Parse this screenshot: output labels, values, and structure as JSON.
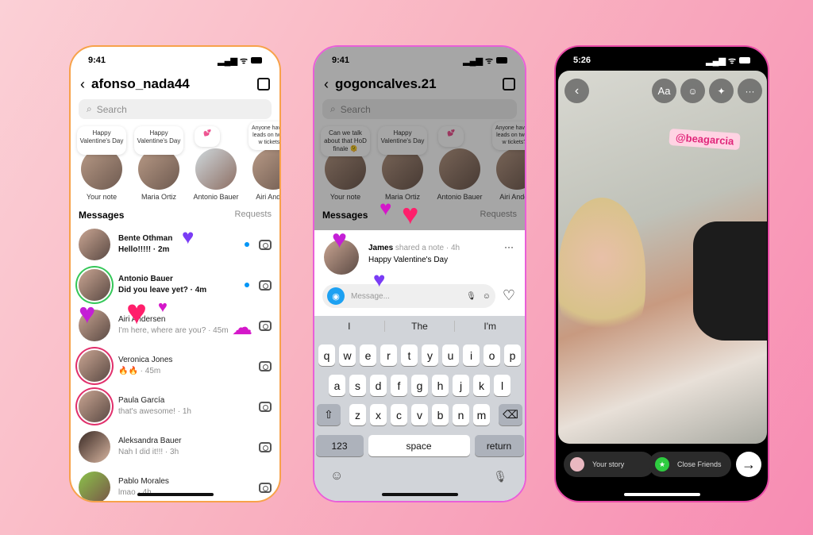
{
  "phone1": {
    "time": "9:41",
    "title": "afonso_nada44",
    "search_placeholder": "Search",
    "notes": [
      {
        "bubble": "Happy Valentine's Day",
        "name": "Your note"
      },
      {
        "bubble": "Happy Valentine's Day",
        "name": "Maria Ortiz"
      },
      {
        "bubble": "💕",
        "name": "Antonio Bauer"
      },
      {
        "bubble": "Anyone have any leads on two BM w tickets?! •",
        "name": "Airi Anders"
      }
    ],
    "messages_label": "Messages",
    "requests_label": "Requests",
    "threads": [
      {
        "name": "Bente Othman",
        "preview": "Hello!!!!! · 2m",
        "unread": true
      },
      {
        "name": "Antonio Bauer",
        "preview": "Did you leave yet? · 4m",
        "unread": true
      },
      {
        "name": "Airi Andersen",
        "preview": "I'm here, where are you? · 45m",
        "unread": false
      },
      {
        "name": "Veronica Jones",
        "preview": "🔥🔥 · 45m",
        "unread": false
      },
      {
        "name": "Paula García",
        "preview": "that's awesome! · 1h",
        "unread": false
      },
      {
        "name": "Aleksandra Bauer",
        "preview": "Nah I did it!!! · 3h",
        "unread": false
      },
      {
        "name": "Pablo Morales",
        "preview": "lmao · 4h",
        "unread": false
      }
    ]
  },
  "phone2": {
    "time": "9:41",
    "title": "gogoncalves.21",
    "search_placeholder": "Search",
    "notes": [
      {
        "bubble": "Can we talk about that HoD finale 🫠",
        "name": "Your note"
      },
      {
        "bubble": "Happy Valentine's Day",
        "name": "Maria Ortiz"
      },
      {
        "bubble": "💕",
        "name": "Antonio Bauer"
      },
      {
        "bubble": "Anyone have any leads on two BM w tickets?! •",
        "name": "Airi Anders"
      }
    ],
    "messages_label": "Messages",
    "requests_label": "Requests",
    "note_sheet": {
      "author": "James",
      "meta": "shared a note · 4h",
      "text": "Happy Valentine's Day",
      "message_placeholder": "Message..."
    },
    "keyboard": {
      "suggestions": [
        "I",
        "The",
        "I'm"
      ],
      "row1": [
        "q",
        "w",
        "e",
        "r",
        "t",
        "y",
        "u",
        "i",
        "o",
        "p"
      ],
      "row2": [
        "a",
        "s",
        "d",
        "f",
        "g",
        "h",
        "j",
        "k",
        "l"
      ],
      "row3": [
        "z",
        "x",
        "c",
        "v",
        "b",
        "n",
        "m"
      ],
      "numbers": "123",
      "space": "space",
      "return": "return"
    }
  },
  "phone3": {
    "time": "5:26",
    "text_tool": "Aa",
    "mention": "@beagarcia",
    "your_story": "Your story",
    "close_friends": "Close Friends"
  },
  "colors": {
    "accent": "#0095f6",
    "heart": "#ff1f6b",
    "purple": "#7a3cf5"
  }
}
